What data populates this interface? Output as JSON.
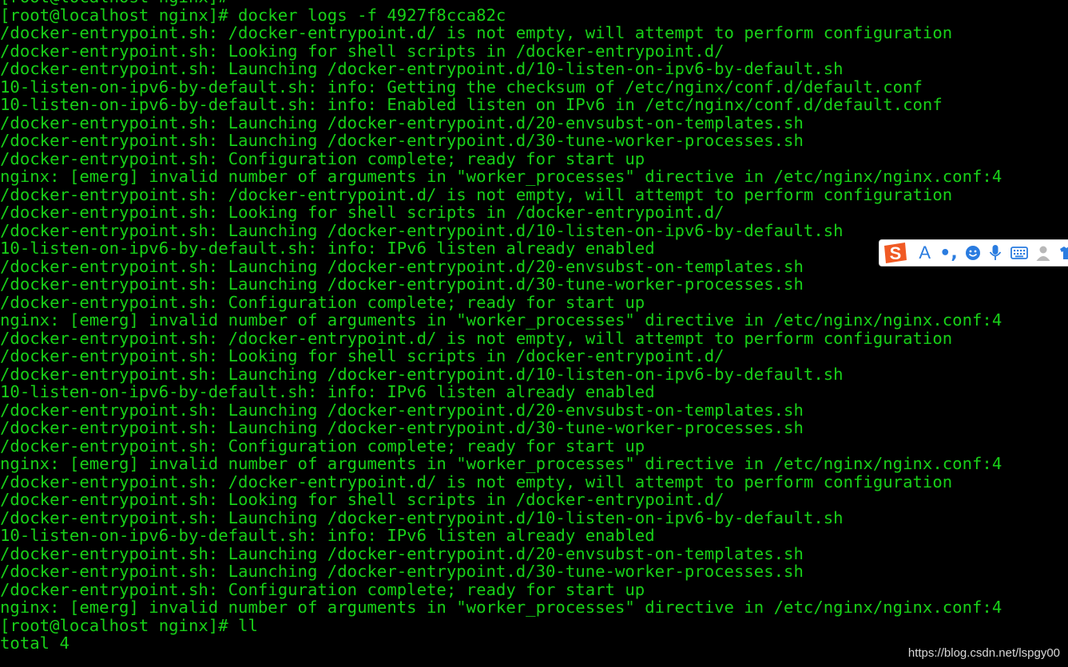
{
  "terminal": {
    "lines": [
      "[root@localhost nginx]#",
      "[root@localhost nginx]# docker logs -f 4927f8cca82c",
      "/docker-entrypoint.sh: /docker-entrypoint.d/ is not empty, will attempt to perform configuration",
      "/docker-entrypoint.sh: Looking for shell scripts in /docker-entrypoint.d/",
      "/docker-entrypoint.sh: Launching /docker-entrypoint.d/10-listen-on-ipv6-by-default.sh",
      "10-listen-on-ipv6-by-default.sh: info: Getting the checksum of /etc/nginx/conf.d/default.conf",
      "10-listen-on-ipv6-by-default.sh: info: Enabled listen on IPv6 in /etc/nginx/conf.d/default.conf",
      "/docker-entrypoint.sh: Launching /docker-entrypoint.d/20-envsubst-on-templates.sh",
      "/docker-entrypoint.sh: Launching /docker-entrypoint.d/30-tune-worker-processes.sh",
      "/docker-entrypoint.sh: Configuration complete; ready for start up",
      "nginx: [emerg] invalid number of arguments in \"worker_processes\" directive in /etc/nginx/nginx.conf:4",
      "/docker-entrypoint.sh: /docker-entrypoint.d/ is not empty, will attempt to perform configuration",
      "/docker-entrypoint.sh: Looking for shell scripts in /docker-entrypoint.d/",
      "/docker-entrypoint.sh: Launching /docker-entrypoint.d/10-listen-on-ipv6-by-default.sh",
      "10-listen-on-ipv6-by-default.sh: info: IPv6 listen already enabled",
      "/docker-entrypoint.sh: Launching /docker-entrypoint.d/20-envsubst-on-templates.sh",
      "/docker-entrypoint.sh: Launching /docker-entrypoint.d/30-tune-worker-processes.sh",
      "/docker-entrypoint.sh: Configuration complete; ready for start up",
      "nginx: [emerg] invalid number of arguments in \"worker_processes\" directive in /etc/nginx/nginx.conf:4",
      "/docker-entrypoint.sh: /docker-entrypoint.d/ is not empty, will attempt to perform configuration",
      "/docker-entrypoint.sh: Looking for shell scripts in /docker-entrypoint.d/",
      "/docker-entrypoint.sh: Launching /docker-entrypoint.d/10-listen-on-ipv6-by-default.sh",
      "10-listen-on-ipv6-by-default.sh: info: IPv6 listen already enabled",
      "/docker-entrypoint.sh: Launching /docker-entrypoint.d/20-envsubst-on-templates.sh",
      "/docker-entrypoint.sh: Launching /docker-entrypoint.d/30-tune-worker-processes.sh",
      "/docker-entrypoint.sh: Configuration complete; ready for start up",
      "nginx: [emerg] invalid number of arguments in \"worker_processes\" directive in /etc/nginx/nginx.conf:4",
      "/docker-entrypoint.sh: /docker-entrypoint.d/ is not empty, will attempt to perform configuration",
      "/docker-entrypoint.sh: Looking for shell scripts in /docker-entrypoint.d/",
      "/docker-entrypoint.sh: Launching /docker-entrypoint.d/10-listen-on-ipv6-by-default.sh",
      "10-listen-on-ipv6-by-default.sh: info: IPv6 listen already enabled",
      "/docker-entrypoint.sh: Launching /docker-entrypoint.d/20-envsubst-on-templates.sh",
      "/docker-entrypoint.sh: Launching /docker-entrypoint.d/30-tune-worker-processes.sh",
      "/docker-entrypoint.sh: Configuration complete; ready for start up",
      "nginx: [emerg] invalid number of arguments in \"worker_processes\" directive in /etc/nginx/nginx.conf:4",
      "[root@localhost nginx]# ll",
      "total 4"
    ]
  },
  "ime_toolbar": {
    "logo_letter": "S",
    "font_mode": "A",
    "punct_mode": "•,",
    "icons": [
      "emoji-icon",
      "microphone-icon",
      "keyboard-icon",
      "user-icon",
      "shirt-icon"
    ]
  },
  "watermark": {
    "text": "https://blog.csdn.net/lspgy00"
  },
  "colors": {
    "background": "#000000",
    "terminal_text": "#18d018",
    "ime_accent": "#2a7ce0",
    "ime_logo": "#f05a24"
  }
}
